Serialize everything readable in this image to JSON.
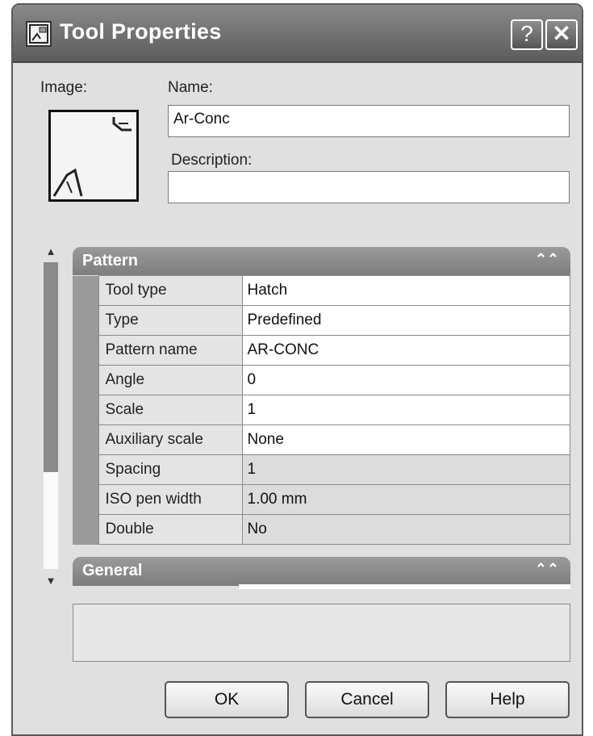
{
  "window": {
    "title": "Tool Properties",
    "help_label": "?",
    "close_label": "✕"
  },
  "labels": {
    "image": "Image:",
    "name": "Name:",
    "description": "Description:"
  },
  "fields": {
    "name_value": "Ar-Conc",
    "description_value": ""
  },
  "sections": {
    "pattern": {
      "title": "Pattern",
      "rows": [
        {
          "name": "Tool type",
          "value": "Hatch"
        },
        {
          "name": "Type",
          "value": "Predefined"
        },
        {
          "name": "Pattern name",
          "value": "AR-CONC"
        },
        {
          "name": "Angle",
          "value": "0"
        },
        {
          "name": "Scale",
          "value": "1"
        },
        {
          "name": "Auxiliary scale",
          "value": "None"
        },
        {
          "name": "Spacing",
          "value": "1"
        },
        {
          "name": "ISO pen width",
          "value": "1.00 mm"
        },
        {
          "name": "Double",
          "value": "No"
        }
      ]
    },
    "general": {
      "title": "General"
    }
  },
  "icons": {
    "collapse": "⌃⌃",
    "scroll_up": "▲",
    "scroll_down": "▼"
  },
  "buttons": {
    "ok": "OK",
    "cancel": "Cancel",
    "help": "Help"
  }
}
